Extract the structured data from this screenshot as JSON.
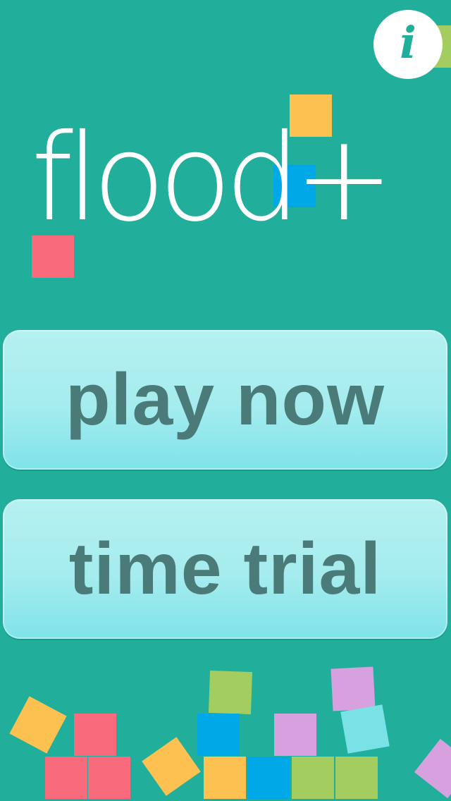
{
  "app": {
    "logo_text": "flood+",
    "info_glyph": "i"
  },
  "menu": {
    "play_label": "play now",
    "time_trial_label": "time trial"
  },
  "icons": {
    "info": "info-icon"
  },
  "colors": {
    "background": "#21ae9b",
    "orange": "#fdc152",
    "blue": "#00a8e7",
    "red": "#f96a7c",
    "green": "#a4cd60",
    "lilac": "#d7a0de",
    "cyan": "#79e2e6",
    "button_text": "#4a7b79"
  }
}
